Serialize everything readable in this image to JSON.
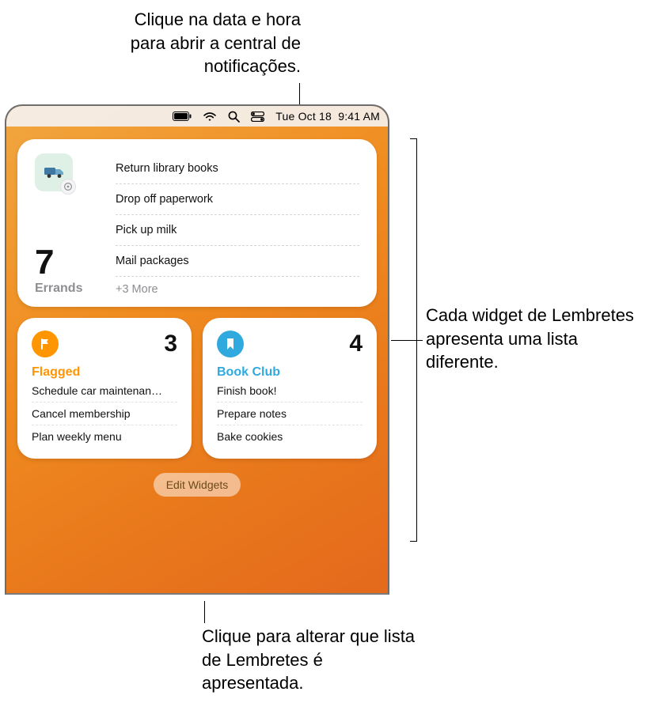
{
  "callouts": {
    "top": "Clique na data e hora para abrir a central de notificações.",
    "right": "Cada widget de Lembretes apresenta uma lista diferente.",
    "bottom": "Clique para alterar que lista de Lembretes é apresentada."
  },
  "menubar": {
    "battery_icon": "battery-icon",
    "wifi_icon": "wifi-icon",
    "search_icon": "search-icon",
    "control_center_icon": "control-center-icon",
    "date": "Tue Oct 18",
    "time": "9:41 AM"
  },
  "widgets": {
    "errands": {
      "icon_name": "errands-list-icon",
      "gear_icon": "gear-icon",
      "count": "7",
      "name": "Errands",
      "items": [
        "Return library books",
        "Drop off paperwork",
        "Pick up milk",
        "Mail packages"
      ],
      "more": "+3 More"
    },
    "flagged": {
      "icon_name": "flag-icon",
      "accent": "#ff9500",
      "count": "3",
      "name": "Flagged",
      "items": [
        "Schedule car maintenan…",
        "Cancel membership",
        "Plan weekly menu"
      ]
    },
    "bookclub": {
      "icon_name": "bookmark-icon",
      "accent": "#30a9de",
      "count": "4",
      "name": "Book Club",
      "items": [
        "Finish book!",
        "Prepare notes",
        "Bake cookies"
      ]
    }
  },
  "edit_widgets_label": "Edit Widgets"
}
